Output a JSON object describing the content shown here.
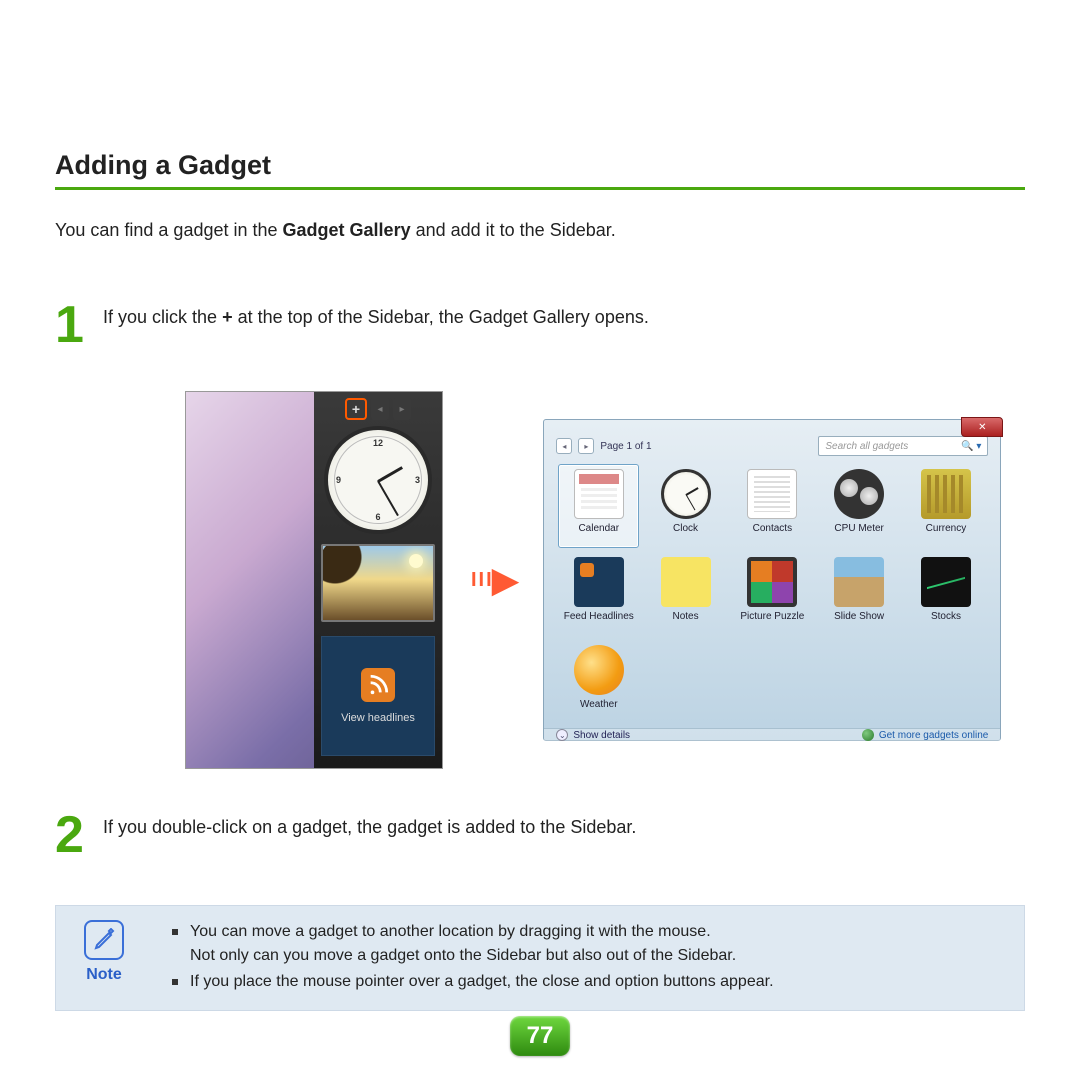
{
  "title": "Adding a Gadget",
  "intro_pre": "You can find a gadget in the ",
  "intro_bold": "Gadget Gallery",
  "intro_post": " and add it to the Sidebar.",
  "step1_num": "1",
  "step1_pre": "If you click the ",
  "step1_bold": "+",
  "step1_post": " at the top of the Sidebar, the Gadget Gallery opens.",
  "step2_num": "2",
  "step2_text": "If you double-click on a gadget, the gadget is added to the Sidebar.",
  "sidebar_fig": {
    "plus": "+",
    "prev": "◂",
    "next": "▸",
    "clock": {
      "n12": "12",
      "n3": "3",
      "n6": "6",
      "n9": "9"
    },
    "feed_label": "View headlines"
  },
  "gallery_fig": {
    "close": "✕",
    "pager_prev": "◂",
    "pager_next": "▸",
    "pager_label": "Page 1 of 1",
    "search_placeholder": "Search all gadgets",
    "search_icon": "🔍 ▾",
    "gadgets": [
      {
        "label": "Calendar",
        "icon": "ic-cal",
        "selected": true
      },
      {
        "label": "Clock",
        "icon": "ic-clock"
      },
      {
        "label": "Contacts",
        "icon": "ic-contacts"
      },
      {
        "label": "CPU Meter",
        "icon": "ic-cpu"
      },
      {
        "label": "Currency",
        "icon": "ic-currency"
      },
      {
        "label": "Feed Headlines",
        "icon": "ic-feed"
      },
      {
        "label": "Notes",
        "icon": "ic-notes"
      },
      {
        "label": "Picture Puzzle",
        "icon": "ic-puzzle"
      },
      {
        "label": "Slide Show",
        "icon": "ic-slide"
      },
      {
        "label": "Stocks",
        "icon": "ic-stocks"
      },
      {
        "label": "Weather",
        "icon": "ic-weather"
      }
    ],
    "details_chevron": "⌄",
    "details": "Show details",
    "more": "Get more gadgets online"
  },
  "note": {
    "label": "Note",
    "b1": "You can move a gadget to another location by dragging it with the mouse.",
    "b1b": "Not only can you move a gadget onto the Sidebar but also out of the Sidebar.",
    "b2": "If you place the mouse pointer over a gadget, the close and option buttons appear."
  },
  "page_number": "77"
}
